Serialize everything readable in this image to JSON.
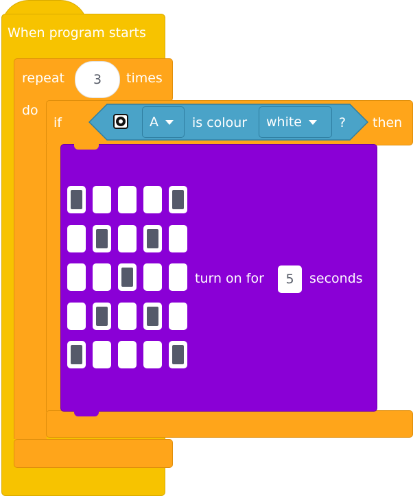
{
  "event_block": {
    "title": "When program starts"
  },
  "repeat_block": {
    "label": "repeat",
    "count": "3",
    "times_label": "times",
    "do_label": "do"
  },
  "if_block": {
    "if_label": "if",
    "then_label": "then",
    "condition": {
      "sensor_icon": "color-sensor-icon",
      "port": "A",
      "text": "is colour",
      "color": "white",
      "question": "?"
    }
  },
  "display_block": {
    "pattern": [
      [
        1,
        0,
        0,
        0,
        1
      ],
      [
        0,
        1,
        0,
        1,
        0
      ],
      [
        0,
        0,
        1,
        0,
        0
      ],
      [
        0,
        1,
        0,
        1,
        0
      ],
      [
        1,
        0,
        0,
        0,
        1
      ]
    ],
    "turn_on_label": "turn on for",
    "seconds_value": "5",
    "seconds_label": "seconds"
  },
  "colors": {
    "event": "#f7c300",
    "control": "#ffa51a",
    "sensor": "#4aa3c8",
    "display": "#8a00d6",
    "led_on": "#555a6a"
  }
}
